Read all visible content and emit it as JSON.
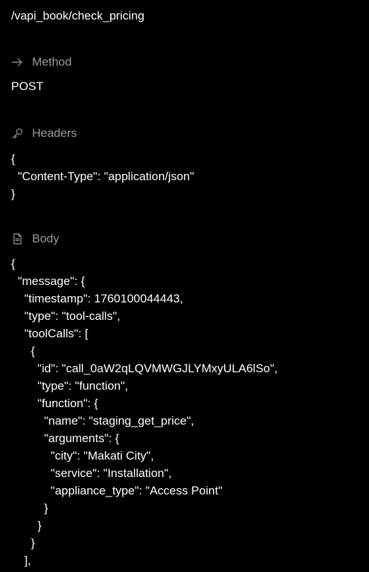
{
  "endpoint": {
    "path": "/vapi_book/check_pricing"
  },
  "method": {
    "label": "Method",
    "icon": "arrow-right-icon",
    "value": "POST"
  },
  "headers": {
    "label": "Headers",
    "icon": "key-icon",
    "json": "{\n  \"Content-Type\": \"application/json\"\n}"
  },
  "body": {
    "label": "Body",
    "icon": "document-icon",
    "json": "{\n  \"message\": {\n    \"timestamp\": 1760100044443,\n    \"type\": \"tool-calls\",\n    \"toolCalls\": [\n      {\n        \"id\": \"call_0aW2qLQVMWGJLYMxyULA6lSo\",\n        \"type\": \"function\",\n        \"function\": {\n          \"name\": \"staging_get_price\",\n          \"arguments\": {\n            \"city\": \"Makati City\",\n            \"service\": \"Installation\",\n            \"appliance_type\": \"Access Point\"\n          }\n        }\n      }\n    ],"
  },
  "colors": {
    "background": "#000000",
    "text": "#ffffff",
    "muted": "#9a9a9a"
  }
}
